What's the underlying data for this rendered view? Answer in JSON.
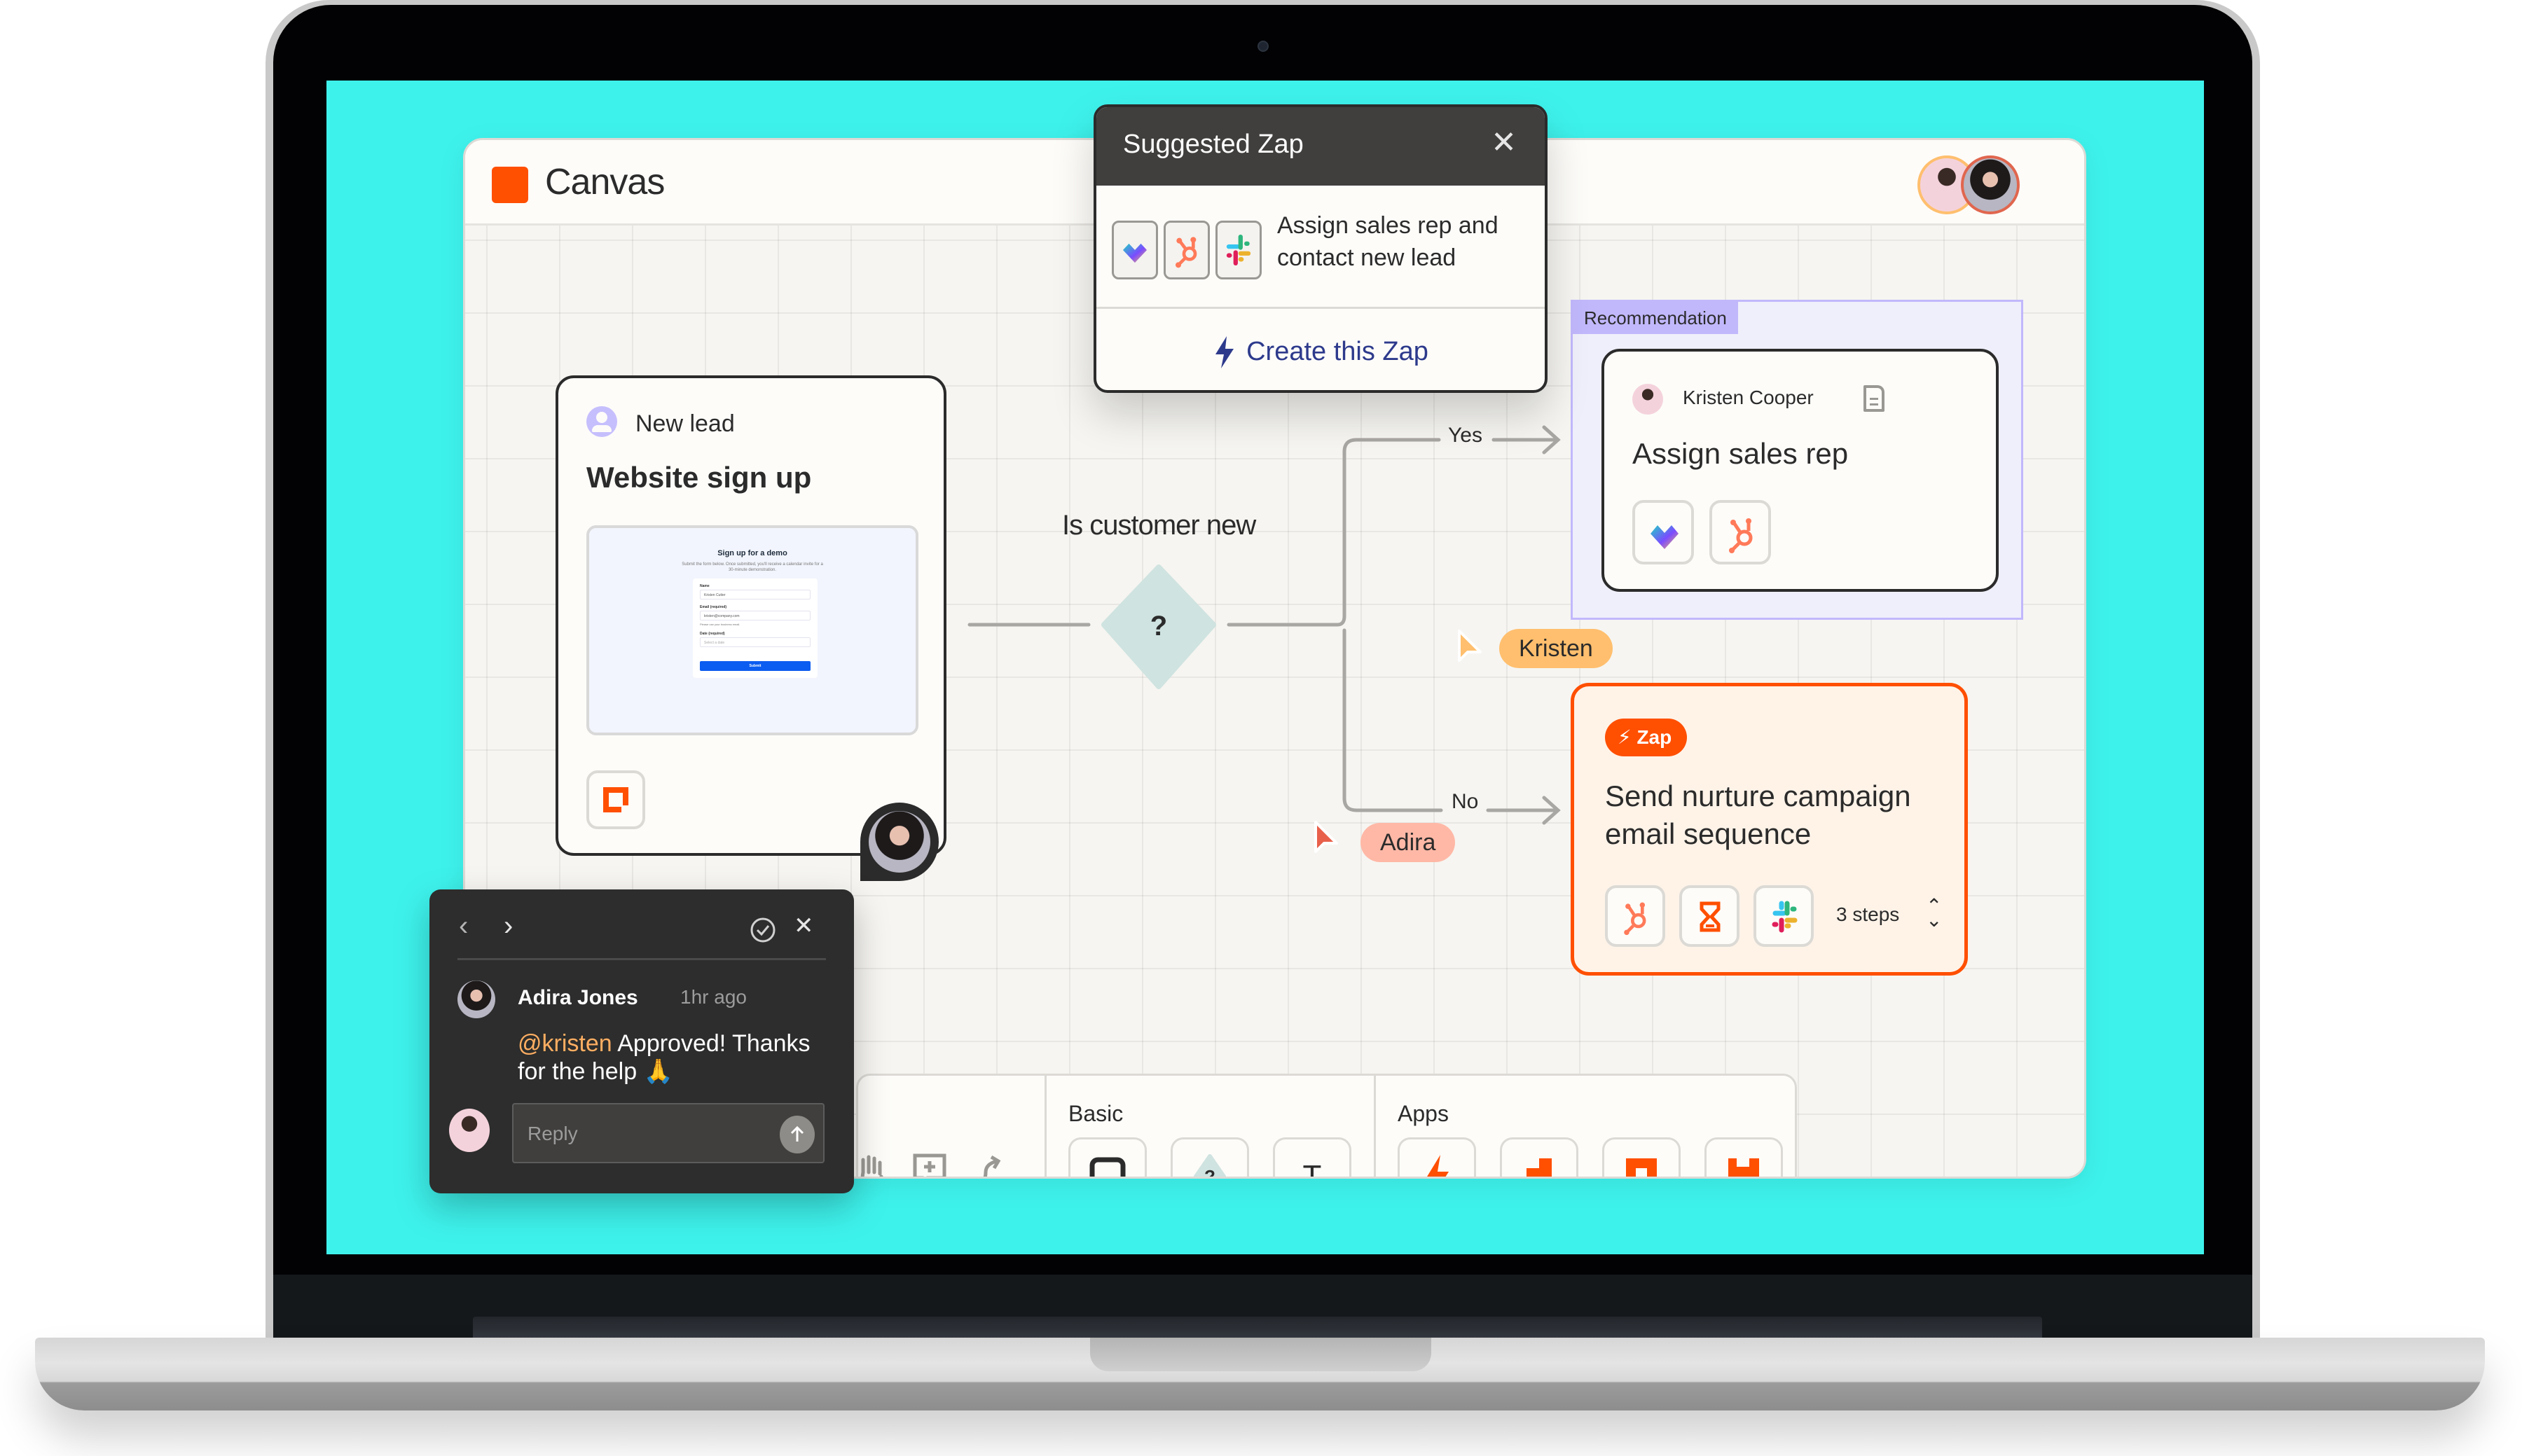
{
  "app": {
    "title": "Canvas",
    "brand_color": "#ff4f00",
    "background_color": "#3ef2ec",
    "collaborators": [
      "Kristen Cooper",
      "Adira Jones"
    ]
  },
  "suggested_zap": {
    "title": "Suggested Zap",
    "close_icon": "close-icon",
    "apps": [
      "monday-icon",
      "hubspot-icon",
      "slack-icon"
    ],
    "description": "Assign sales rep and contact new lead",
    "cta_label": "Create this Zap"
  },
  "new_lead_card": {
    "label": "New lead",
    "title": "Website sign up",
    "form_preview": {
      "title": "Sign up for a demo",
      "description": "Submit the form below. Once submitted, you'll receive a calendar invite for a 30-minute demonstration.",
      "fields": [
        {
          "label": "Name",
          "value": "Kristen Cutter"
        },
        {
          "label": "Email (required)",
          "value": "kristen@company.com",
          "hint": "Please use your business email."
        },
        {
          "label": "Date (required)",
          "placeholder": "Select a date"
        }
      ],
      "submit_label": "Submit"
    },
    "app": "interfaces-icon"
  },
  "decision": {
    "label": "Is customer new",
    "symbol": "?",
    "branches": [
      {
        "label": "Yes"
      },
      {
        "label": "No"
      }
    ]
  },
  "recommendation": {
    "tag": "Recommendation",
    "author": "Kristen Cooper",
    "title": "Assign sales rep",
    "apps": [
      "monday-icon",
      "hubspot-icon"
    ]
  },
  "zap_card": {
    "badge": "Zap",
    "title": "Send nurture campaign email sequence",
    "apps": [
      "hubspot-icon",
      "delay-icon",
      "slack-icon"
    ],
    "steps_label": "3 steps"
  },
  "cursors": [
    {
      "name": "Kristen",
      "color": "#ffbf6e"
    },
    {
      "name": "Adira",
      "color": "#ffb8a6"
    }
  ],
  "toolbar": {
    "tools": [
      "hand-icon",
      "add-comment-icon",
      "connector-icon"
    ],
    "sections": [
      {
        "label": "Basic",
        "items": [
          "rectangle-icon",
          "decision-icon",
          "text-icon"
        ]
      },
      {
        "label": "Apps",
        "items": [
          "zap-icon",
          "tables-icon",
          "interfaces-icon",
          "chatbot-icon"
        ]
      }
    ],
    "decision_symbol": "?",
    "text_symbol": "T"
  },
  "comment": {
    "author": "Adira Jones",
    "time": "1hr ago",
    "mention": "@kristen",
    "text": " Approved! Thanks for the help 🙏",
    "reply_placeholder": "Reply"
  }
}
